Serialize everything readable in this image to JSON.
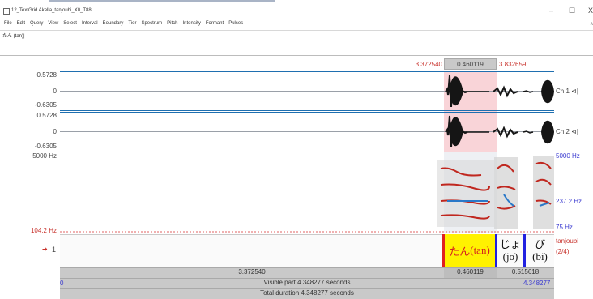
{
  "window": {
    "title": "12_TextGrid Akella_tanjoubi_X0_T88",
    "minimize": "–",
    "maximize": "☐",
    "close": "X"
  },
  "menu": [
    "File",
    "Edit",
    "Query",
    "View",
    "Select",
    "Interval",
    "Boundary",
    "Tier",
    "Spectrum",
    "Pitch",
    "Intensity",
    "Formant",
    "Pulses"
  ],
  "text_field": "たん (tan)|",
  "selection_bar": {
    "start": "3.372540",
    "length": "0.460119",
    "end": "3.832659"
  },
  "channels": [
    {
      "top": "0.5728",
      "zero": "0",
      "bottom": "-0.6305",
      "label": "Ch 1 ⊲|"
    },
    {
      "top": "0.5728",
      "zero": "0",
      "bottom": "-0.6305",
      "label": "Ch 2 ⊲|"
    }
  ],
  "spectrogram": {
    "top_left": "5000 Hz",
    "top_right": "5000 Hz",
    "bottom_left": "104.2 Hz",
    "pitch_value": "237.2 Hz",
    "bottom_right": "75 Hz"
  },
  "tier": {
    "number": "1",
    "arrow": "➔",
    "name": "tanjoubi",
    "count": "(2/4)",
    "intervals": [
      {
        "kana": "たん",
        "roma": "(tan)",
        "selected": true
      },
      {
        "kana": "じょ",
        "roma": "(jo)",
        "selected": false
      },
      {
        "kana": "び",
        "roma": "(bi)",
        "selected": false
      }
    ]
  },
  "time_bar": {
    "before": "3.372540",
    "sel": "0.460119",
    "after": "0.515618"
  },
  "visible_bar": {
    "start": "0",
    "label": "Visible part 4.348277 seconds",
    "end": "4.348277"
  },
  "total_bar": {
    "label": "Total duration 4.348277 seconds"
  },
  "colors": {
    "selection": "#f9d4d8",
    "interval_highlight": "#fff200",
    "boundary_red": "#e02020",
    "boundary_blue": "#2020e0",
    "accent_blue": "#1f6fb0"
  }
}
